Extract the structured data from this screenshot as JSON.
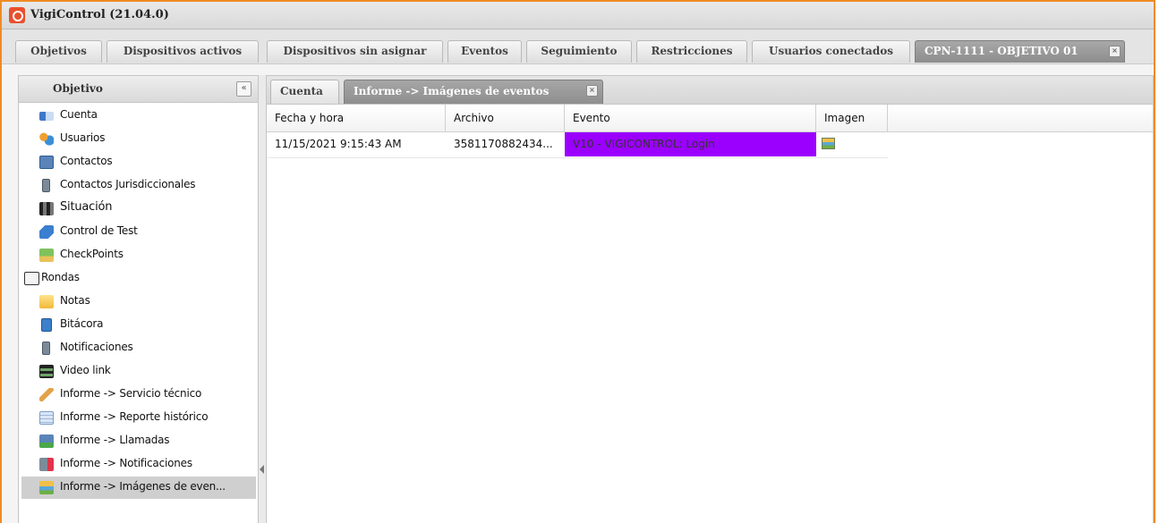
{
  "app": {
    "title": "VigiControl (21.04.0)"
  },
  "tabs": [
    {
      "label": "Objetivos"
    },
    {
      "label": "Dispositivos activos"
    },
    {
      "label": "Dispositivos sin asignar"
    },
    {
      "label": "Eventos"
    },
    {
      "label": "Seguimiento"
    },
    {
      "label": "Restricciones"
    },
    {
      "label": "Usuarios conectados"
    },
    {
      "label": "CPN-1111 - OBJETIVO 01",
      "active": true
    }
  ],
  "sidebar": {
    "title": "Objetivo",
    "collapse_icon": "«",
    "items": [
      {
        "label": "Cuenta",
        "icon": "account-card-icon"
      },
      {
        "label": "Usuarios",
        "icon": "users-icon"
      },
      {
        "label": "Contactos",
        "icon": "phone-icon"
      },
      {
        "label": "Contactos Jurisdiccionales",
        "icon": "mobile-phone-icon"
      },
      {
        "label": "Situación",
        "icon": "binoculars-icon"
      },
      {
        "label": "Control de Test",
        "icon": "test-icon"
      },
      {
        "label": "CheckPoints",
        "icon": "map-checkpoints-icon"
      },
      {
        "label": "Rondas",
        "icon": "map-rounds-icon"
      },
      {
        "label": "Notas",
        "icon": "notes-icon"
      },
      {
        "label": "Bitácora",
        "icon": "log-book-icon"
      },
      {
        "label": "Notificaciones",
        "icon": "mobile-phone-icon"
      },
      {
        "label": "Video link",
        "icon": "film-icon"
      },
      {
        "label": "Informe -> Servicio técnico",
        "icon": "wrench-icon"
      },
      {
        "label": "Informe -> Reporte histórico",
        "icon": "report-icon"
      },
      {
        "label": "Informe -> Llamadas",
        "icon": "call-report-icon"
      },
      {
        "label": "Informe -> Notificaciones",
        "icon": "notification-report-icon"
      },
      {
        "label": "Informe -> Imágenes de even...",
        "icon": "images-report-icon",
        "selected": true
      }
    ]
  },
  "subtabs": [
    {
      "label": "Cuenta"
    },
    {
      "label": "Informe -> Imágenes de eventos",
      "active": true
    }
  ],
  "grid": {
    "columns": [
      "Fecha y hora",
      "Archivo",
      "Evento",
      "Imagen"
    ],
    "rows": [
      {
        "fecha": "11/15/2021 9:15:43 AM",
        "archivo": "3581170882434...",
        "evento": "V10 - VIGICONTROL: Login",
        "imagen_icon": "image-icon"
      }
    ]
  },
  "colors": {
    "accent_border": "#f08a24",
    "event_highlight": "#9b00ff"
  }
}
